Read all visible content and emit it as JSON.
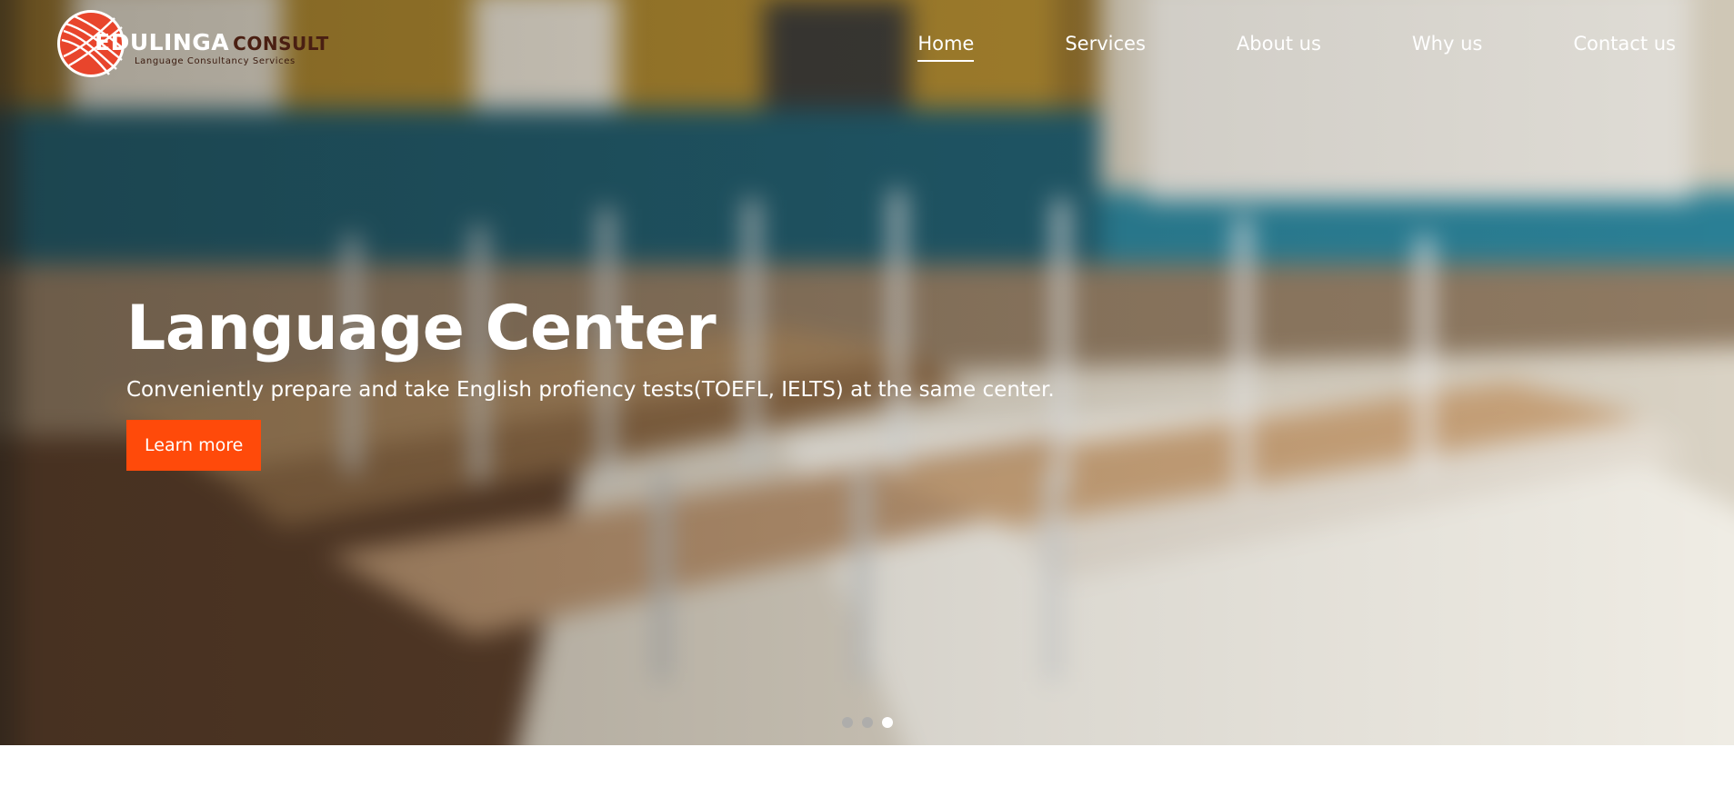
{
  "brand": {
    "name_part1": "EDULINGA",
    "name_part2": "CONSULT",
    "tagline": "Language Consultancy Services",
    "logo_icon": "globe-lines-logo-icon",
    "brand_color": "#e8452c",
    "brand_dark": "#4a1f12"
  },
  "nav": {
    "items": [
      {
        "label": "Home",
        "active": true
      },
      {
        "label": "Services",
        "active": false
      },
      {
        "label": "About us",
        "active": false
      },
      {
        "label": "Why us",
        "active": false
      },
      {
        "label": "Contact us",
        "active": false
      }
    ]
  },
  "hero": {
    "title": "Language Center",
    "subtitle": "Conveniently prepare and take English profiency tests(TOEFL, IELTS) at the same center.",
    "cta_label": "Learn more",
    "cta_color": "#ff4a0a",
    "slides_total": 3,
    "active_slide": 3
  }
}
